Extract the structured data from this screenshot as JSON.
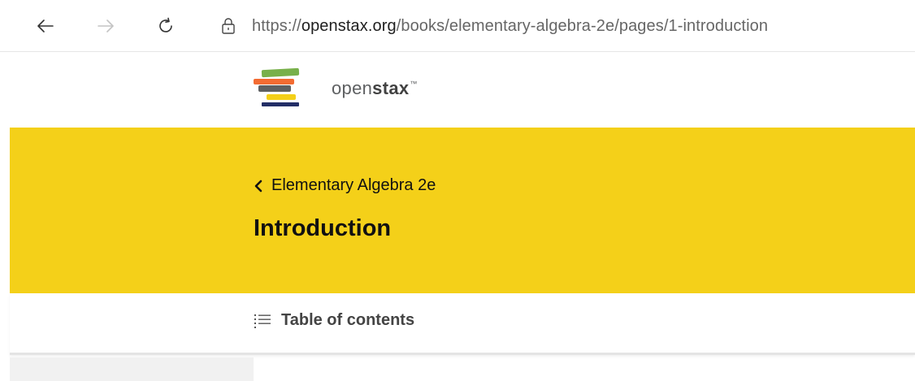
{
  "browser": {
    "back_icon": "arrow-left-icon",
    "forward_icon": "arrow-right-icon",
    "refresh_icon": "refresh-icon",
    "lock_icon": "lock-icon",
    "url_prefix": "https://",
    "url_domain": "openstax.org",
    "url_path": "/books/elementary-algebra-2e/pages/1-introduction"
  },
  "header": {
    "logo_light": "open",
    "logo_bold": "stax",
    "logo_tm": "™"
  },
  "hero": {
    "back_label": "Elementary Algebra 2e",
    "title": "Introduction",
    "background": "#f4d019"
  },
  "toc": {
    "label": "Table of contents",
    "icon": "list-icon"
  }
}
